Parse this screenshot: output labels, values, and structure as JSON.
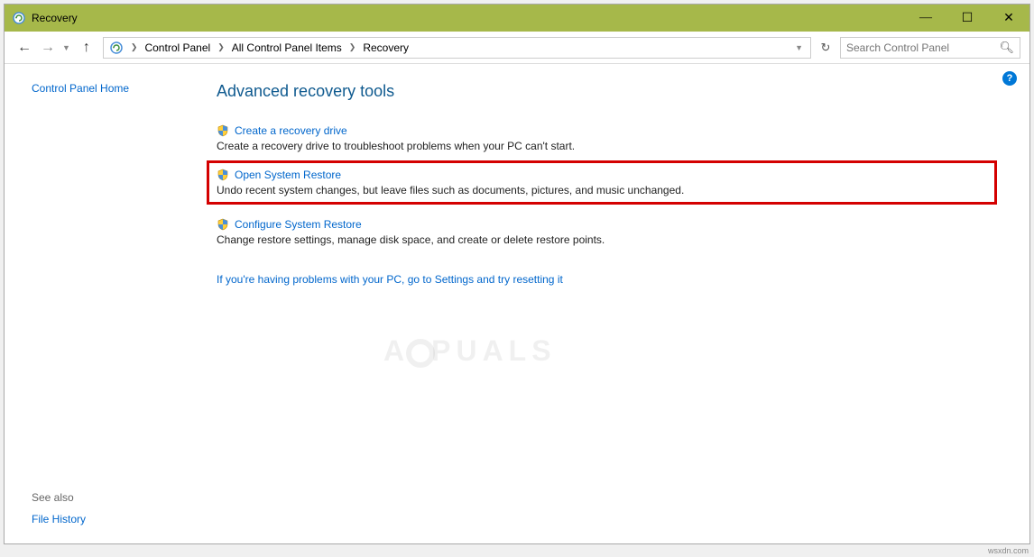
{
  "window": {
    "title": "Recovery"
  },
  "breadcrumb": {
    "items": [
      "Control Panel",
      "All Control Panel Items",
      "Recovery"
    ]
  },
  "search": {
    "placeholder": "Search Control Panel"
  },
  "sidebar": {
    "home": "Control Panel Home",
    "see_also_label": "See also",
    "see_also_link": "File History"
  },
  "main": {
    "heading": "Advanced recovery tools",
    "tools": [
      {
        "title": "Create a recovery drive",
        "desc": "Create a recovery drive to troubleshoot problems when your PC can't start."
      },
      {
        "title": "Open System Restore",
        "desc": "Undo recent system changes, but leave files such as documents, pictures, and music unchanged."
      },
      {
        "title": "Configure System Restore",
        "desc": "Change restore settings, manage disk space, and create or delete restore points."
      }
    ],
    "footer_link": "If you're having problems with your PC, go to Settings and try resetting it"
  },
  "watermark": "A  PUALS",
  "attrib": "wsxdn.com"
}
